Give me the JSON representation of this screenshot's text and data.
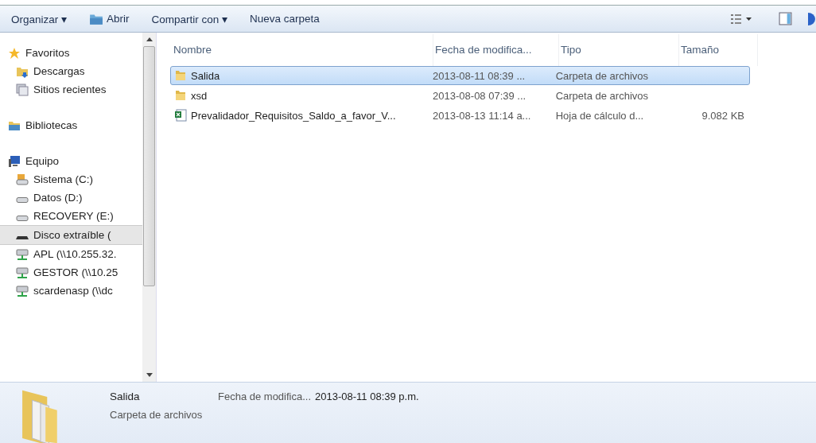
{
  "toolbar": {
    "buttons": [
      {
        "label": "Organizar ▾",
        "kind": "menu"
      },
      {
        "label": "Abrir",
        "kind": "open"
      },
      {
        "label": "Compartir con ▾",
        "kind": "menu"
      },
      {
        "label": "Nueva carpeta",
        "kind": "plain"
      }
    ]
  },
  "navigation": [
    {
      "label": "Favoritos",
      "kind": "favorites",
      "selected": false,
      "children": [
        {
          "label": "Descargas",
          "kind": "downloads",
          "selected": false
        },
        {
          "label": "Sitios recientes",
          "kind": "recent",
          "selected": false
        }
      ]
    },
    {
      "label": "Bibliotecas",
      "kind": "library",
      "selected": false
    },
    {
      "label": "Equipo",
      "kind": "computer",
      "selected": false,
      "children": [
        {
          "label": "Sistema (C:)",
          "kind": "system-drive",
          "selected": false
        },
        {
          "label": "Datos (D:)",
          "kind": "drive",
          "selected": false
        },
        {
          "label": "RECOVERY (E:)",
          "kind": "drive",
          "selected": false
        },
        {
          "label": "Disco extraíble (",
          "kind": "removable",
          "selected": true
        },
        {
          "label": "APL (\\\\10.255.32.",
          "kind": "network",
          "selected": false
        },
        {
          "label": "GESTOR (\\\\10.25",
          "kind": "network",
          "selected": false
        },
        {
          "label": "scardenasp (\\\\dc",
          "kind": "network",
          "selected": false
        }
      ]
    }
  ],
  "table": {
    "columns": [
      "Nombre",
      "Fecha de modifica...",
      "Tipo",
      "Tamaño"
    ],
    "rows": [
      {
        "name": "Salida",
        "kind": "folder",
        "selected": true,
        "modified": "2013-08-11 08:39 ...",
        "type": "Carpeta de archivos"
      },
      {
        "name": "xsd",
        "kind": "folder",
        "selected": false,
        "modified": "2013-08-08 07:39 ...",
        "type": "Carpeta de archivos"
      },
      {
        "name": "Prevalidador_Requisitos_Saldo_a_favor_V...",
        "kind": "spreadsheet",
        "selected": false,
        "modified": "2013-08-13 11:14 a...",
        "type": "Hoja de cálculo d...",
        "size": "9.082 KB"
      }
    ]
  },
  "details": {
    "name": "Salida",
    "type": "Carpeta de archivos",
    "field_label": "Fecha de modifica...",
    "field_value": "2013-08-11 08:39 p.m."
  }
}
